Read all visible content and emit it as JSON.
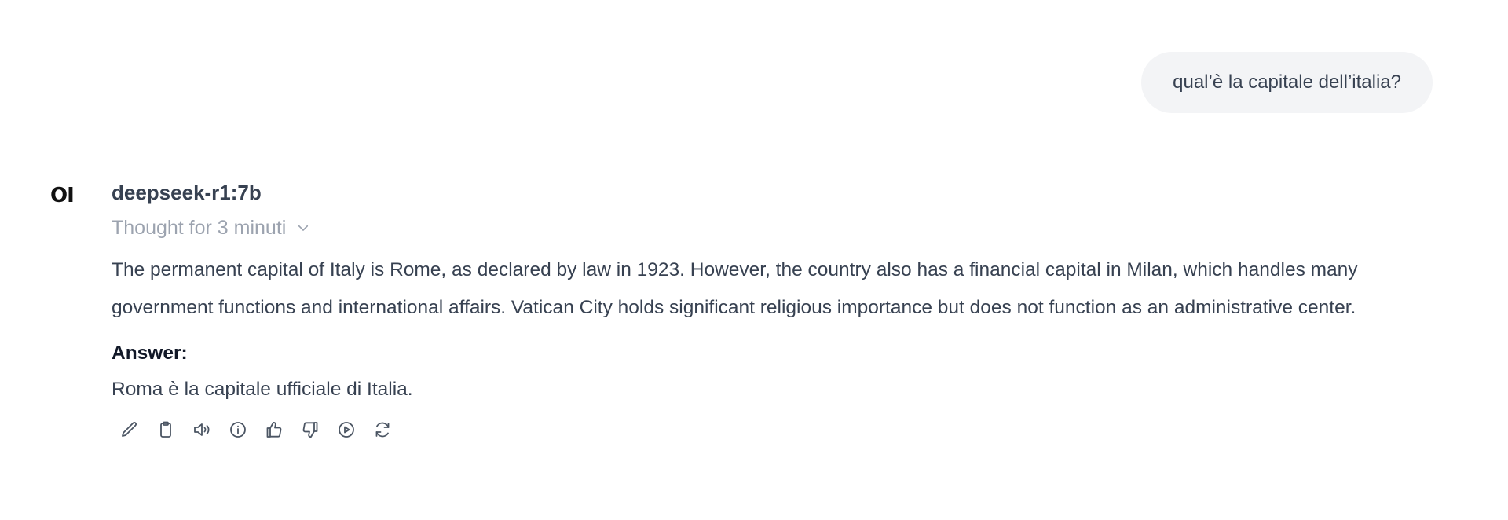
{
  "user_message": {
    "text": "qual’è la capitale dell’italia?"
  },
  "assistant": {
    "logo_text": "OI",
    "model_name": "deepseek-r1:7b",
    "thought_label": "Thought for 3 minuti",
    "thought_chevron_icon": "chevron-down-icon",
    "paragraph": "The permanent capital of Italy is Rome, as declared by law in 1923. However, the country also has a financial capital in Milan, which handles many government functions and international affairs. Vatican City holds significant religious importance but does not function as an administrative center.",
    "answer_label": "Answer:",
    "answer_text": "Roma è la capitale ufficiale di Italia."
  },
  "actions": [
    {
      "name": "edit-button",
      "icon": "pencil-icon"
    },
    {
      "name": "copy-button",
      "icon": "clipboard-icon"
    },
    {
      "name": "read-aloud-button",
      "icon": "speaker-icon"
    },
    {
      "name": "info-button",
      "icon": "info-icon"
    },
    {
      "name": "thumbs-up-button",
      "icon": "thumbs-up-icon"
    },
    {
      "name": "thumbs-down-button",
      "icon": "thumbs-down-icon"
    },
    {
      "name": "continue-button",
      "icon": "play-circle-icon"
    },
    {
      "name": "regenerate-button",
      "icon": "refresh-icon"
    }
  ],
  "colors": {
    "user_bubble_bg": "#f3f4f6",
    "text_primary": "#374151",
    "text_muted": "#9ca3af",
    "icon": "#4b5563"
  }
}
